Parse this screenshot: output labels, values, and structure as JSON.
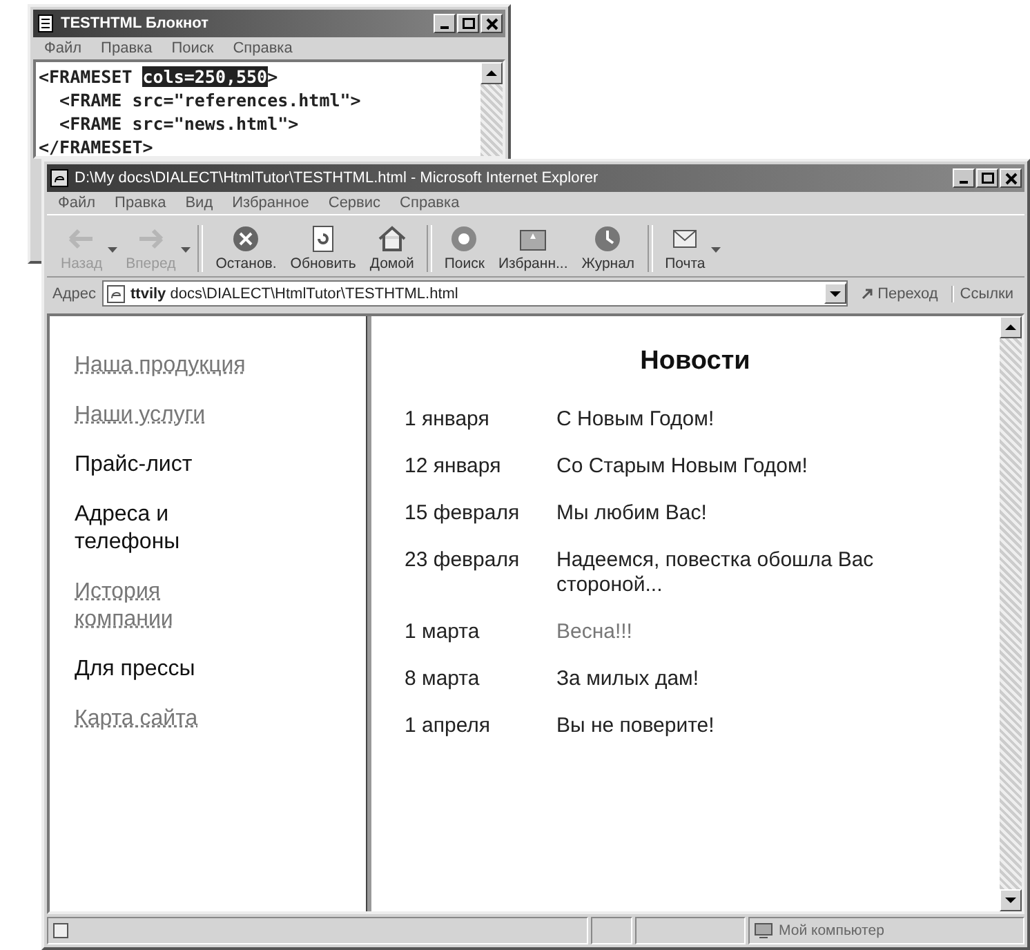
{
  "notepad": {
    "title": "TESTHTML Блокнот",
    "menu": [
      "Файл",
      "Правка",
      "Поиск",
      "Справка"
    ],
    "lines": [
      [
        {
          "text": "<FRAMESET ",
          "selected": false
        },
        {
          "text": "cols=250,550",
          "selected": true
        },
        {
          "text": ">",
          "selected": false
        }
      ],
      [
        {
          "text": "  <FRAME src=\"references.html\">",
          "selected": false
        }
      ],
      [
        {
          "text": "  <FRAME src=\"news.html\">",
          "selected": false
        }
      ],
      [
        {
          "text": "</FRAMESET>",
          "selected": false
        }
      ]
    ]
  },
  "browser": {
    "title": "D:\\My docs\\DIALECT\\HtmlTutor\\TESTHTML.html - Microsoft Internet Explorer",
    "menu": [
      "Файл",
      "Правка",
      "Вид",
      "Избранное",
      "Сервис",
      "Справка"
    ],
    "toolbar": [
      {
        "label": "Назад",
        "disabled": true
      },
      {
        "label": "Вперед",
        "disabled": true
      },
      {
        "label": "Останов.",
        "disabled": false
      },
      {
        "label": "Обновить",
        "disabled": false
      },
      {
        "label": "Домой",
        "disabled": false
      },
      {
        "label": "Поиск",
        "disabled": false
      },
      {
        "label": "Избранн...",
        "disabled": false
      },
      {
        "label": "Журнал",
        "disabled": false
      },
      {
        "label": "Почта",
        "disabled": false
      }
    ],
    "address": {
      "label": "Адрес",
      "value": "**ttvily** docs\\DIALECT\\HtmlTutor\\TESTHTML.html",
      "go": "Переход",
      "links": "Ссылки"
    },
    "sidebar": {
      "items": [
        {
          "text": "Наша продукция",
          "kind": "link"
        },
        {
          "text": "Наши услуги",
          "kind": "link"
        },
        {
          "text": "Прайс-лист",
          "kind": "text"
        },
        {
          "text": "Адреса и телефоны",
          "kind": "text"
        },
        {
          "text": "История компании",
          "kind": "link"
        },
        {
          "text": "Для прессы",
          "kind": "text"
        },
        {
          "text": "Карта сайта",
          "kind": "link"
        }
      ]
    },
    "news": {
      "title": "Новости",
      "rows": [
        {
          "date": "1 января",
          "text": "С Новым Годом!",
          "kind": "text"
        },
        {
          "date": "12 января",
          "text": "Со Старым Новым Годом!",
          "kind": "text"
        },
        {
          "date": "15 февраля",
          "text": "Мы любим Вас!",
          "kind": "text"
        },
        {
          "date": "23 февраля",
          "text": "Надеемся, повестка обошла Вас стороной...",
          "kind": "text"
        },
        {
          "date": "1 марта",
          "text": "Весна!!!",
          "kind": "link"
        },
        {
          "date": "8 марта",
          "text": "За милых дам!",
          "kind": "text"
        },
        {
          "date": "1 апреля",
          "text": "Вы не поверите!",
          "kind": "text"
        }
      ]
    },
    "status_bar": {
      "zone": "Мой компьютер"
    }
  }
}
